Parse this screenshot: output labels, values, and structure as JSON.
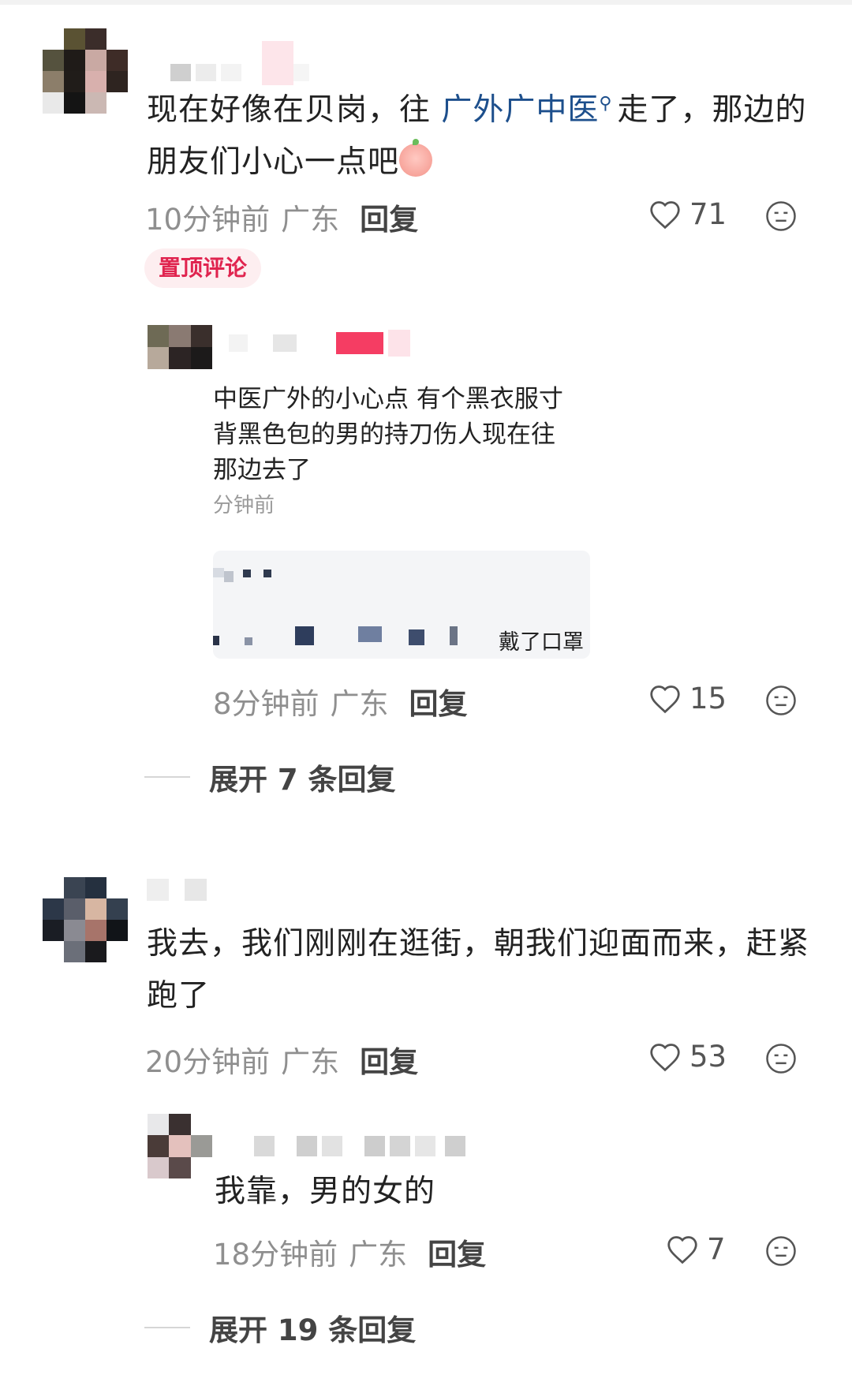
{
  "comments": [
    {
      "text_before": "现在好像在贝岗，往 ",
      "link": "广外广中医",
      "link_icon": "search-icon",
      "text_after": "走了，那边的朋友们小心一点吧",
      "emoji": "peach-crying-emoji",
      "time": "10分钟前",
      "region": "广东",
      "reply": "回复",
      "likes": "71",
      "badge": "置顶评论",
      "reply_item": {
        "image_lines": [
          "中医广外的小心点 有个黑衣服寸",
          "背黑色包的男的持刀伤人现在往",
          "那边去了"
        ],
        "image_time": "分钟前",
        "image_caption": "戴了口罩",
        "time": "8分钟前",
        "region": "广东",
        "reply": "回复",
        "likes": "15"
      },
      "expand": "展开 7 条回复"
    },
    {
      "text": "我去，我们刚刚在逛街，朝我们迎面而来，赶紧跑了",
      "time": "20分钟前",
      "region": "广东",
      "reply": "回复",
      "likes": "53",
      "reply_item": {
        "text": "我靠，男的女的",
        "time": "18分钟前",
        "region": "广东",
        "reply": "回复",
        "likes": "7"
      },
      "expand": "展开 19 条回复"
    }
  ],
  "colors": {
    "link": "#1d4f8c",
    "badge_text": "#e0244f",
    "badge_bg": "#fdeef0",
    "meta": "#8f8f8f"
  },
  "icons": [
    "heart-outline-icon",
    "meh-face-icon",
    "search-icon"
  ]
}
